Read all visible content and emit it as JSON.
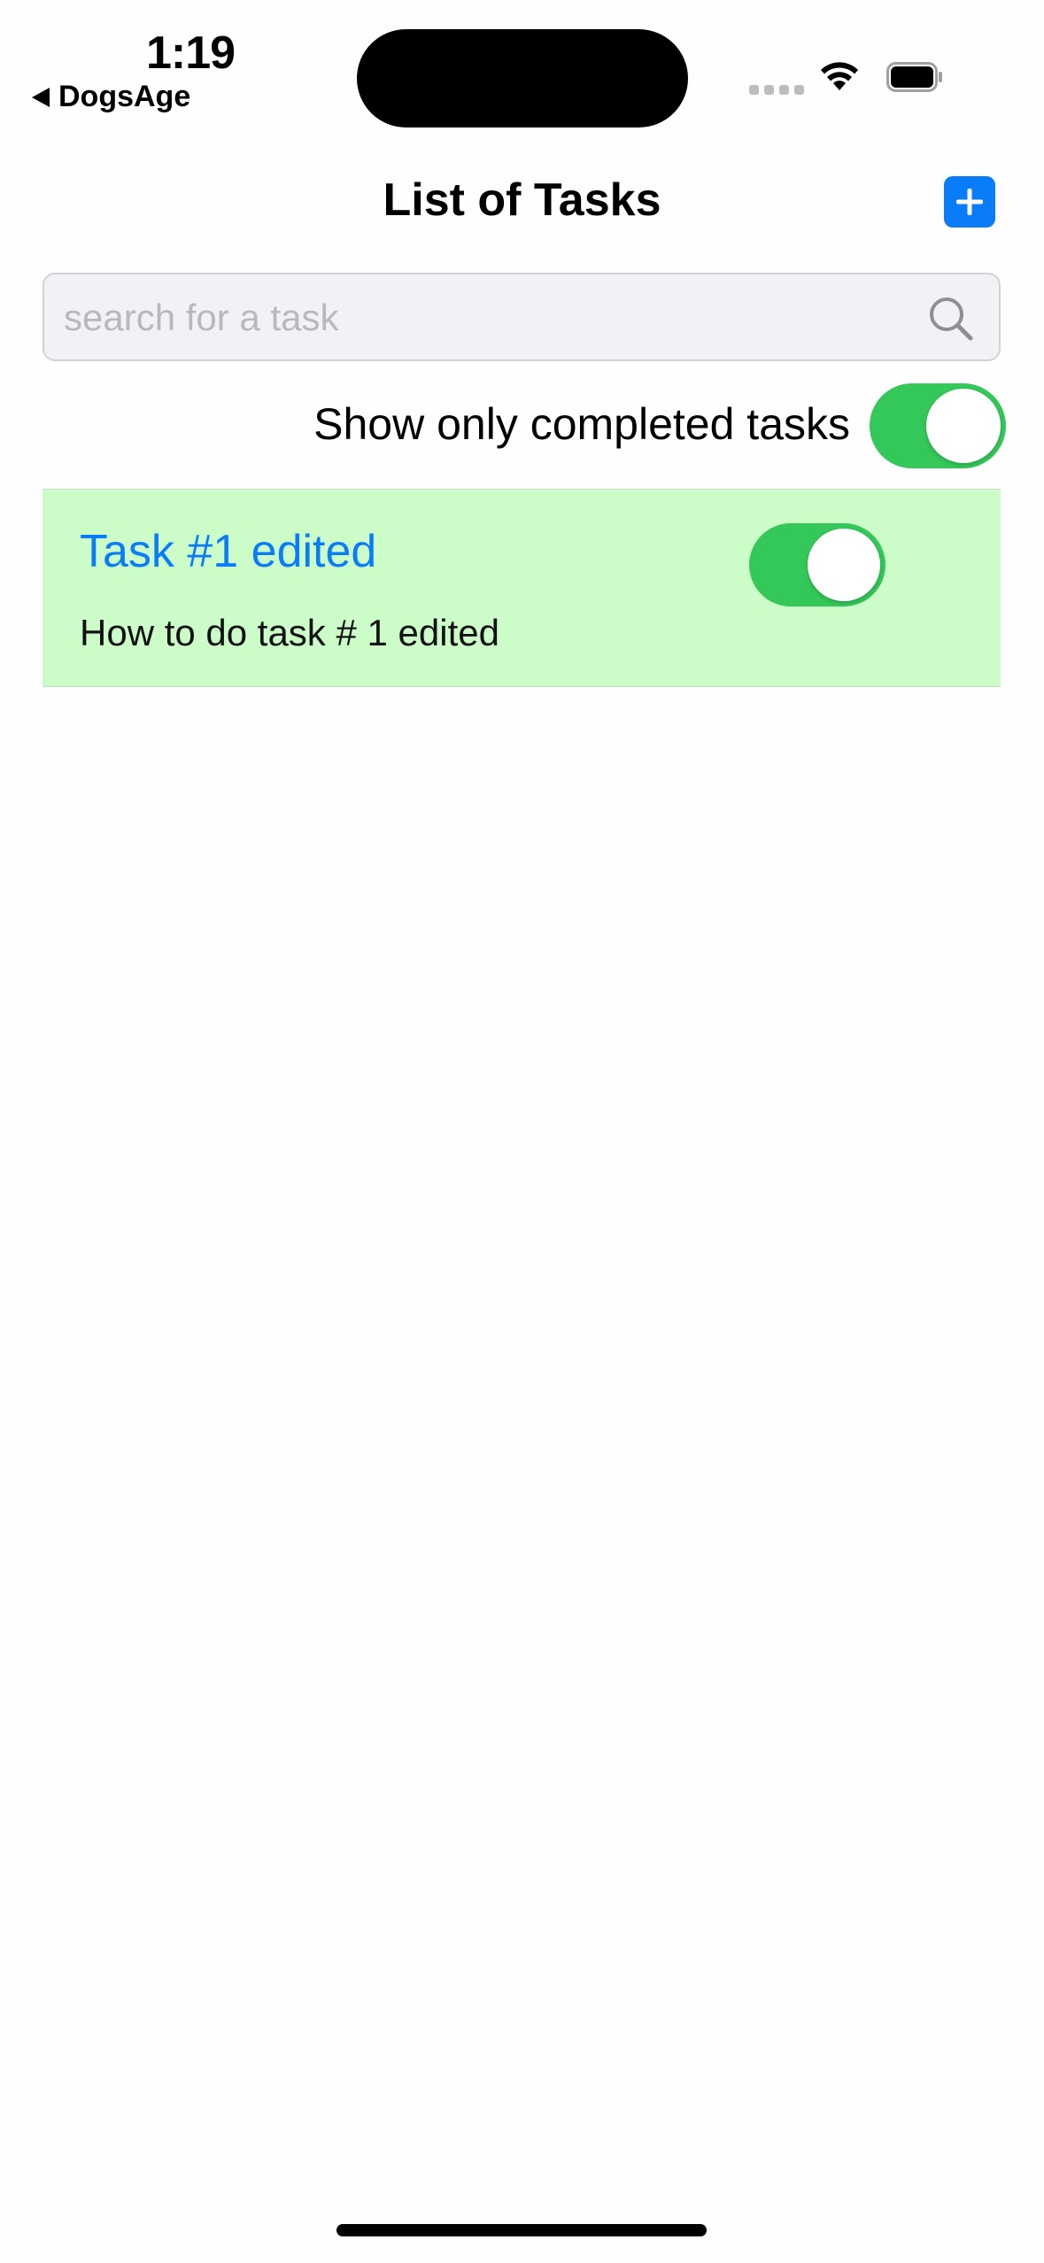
{
  "status_bar": {
    "time": "1:19",
    "back_label": "DogsAge",
    "back_icon": "back-triangle-icon",
    "signal_icon": "cellular-signal-icon",
    "wifi_icon": "wifi-icon",
    "battery_icon": "battery-icon"
  },
  "nav": {
    "title": "List of Tasks",
    "add_icon": "plus-icon"
  },
  "search": {
    "placeholder": "search for a task",
    "value": "",
    "icon": "magnifier-icon"
  },
  "filter": {
    "label": "Show only completed tasks",
    "on": true
  },
  "tasks": [
    {
      "title": "Task #1 edited",
      "description": "How to do task # 1 edited",
      "completed": true
    }
  ],
  "colors": {
    "accent": "#0a7cf7",
    "toggle_on": "#34c759",
    "completed_row": "#ccfdc9",
    "search_bg": "#f2f2f6"
  }
}
